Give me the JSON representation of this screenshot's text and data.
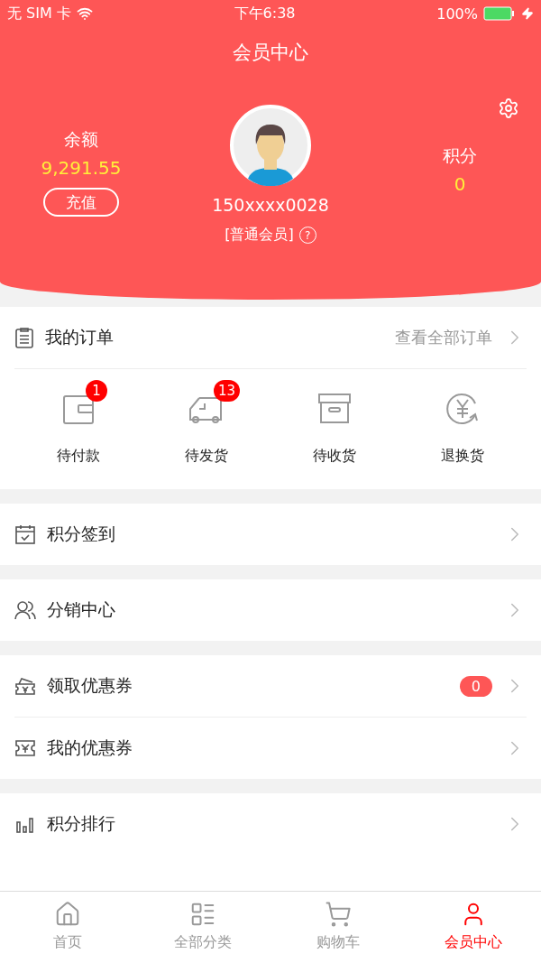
{
  "status_bar": {
    "carrier": "无 SIM 卡",
    "time": "下午6:38",
    "battery": "100%"
  },
  "title": "会员中心",
  "balance": {
    "label": "余额",
    "amount": "9,291.55",
    "button": "充值"
  },
  "user": {
    "phone": "150xxxx0028",
    "level": "[普通会员]",
    "help": "?"
  },
  "points": {
    "label": "积分",
    "value": "0"
  },
  "orders": {
    "title": "我的订单",
    "link": "查看全部订单",
    "items": [
      {
        "label": "待付款",
        "badge": "1"
      },
      {
        "label": "待发货",
        "badge": "13"
      },
      {
        "label": "待收货"
      },
      {
        "label": "退换货"
      }
    ]
  },
  "menu_groups": [
    [
      {
        "label": "积分签到"
      }
    ],
    [
      {
        "label": "分销中心"
      }
    ],
    [
      {
        "label": "领取优惠券",
        "badge": "0"
      },
      {
        "label": "我的优惠券"
      }
    ],
    [
      {
        "label": "积分排行"
      }
    ]
  ],
  "tabs": [
    {
      "label": "首页",
      "selected": false
    },
    {
      "label": "全部分类",
      "selected": false
    },
    {
      "label": "购物车",
      "selected": false
    },
    {
      "label": "会员中心",
      "selected": true
    }
  ]
}
